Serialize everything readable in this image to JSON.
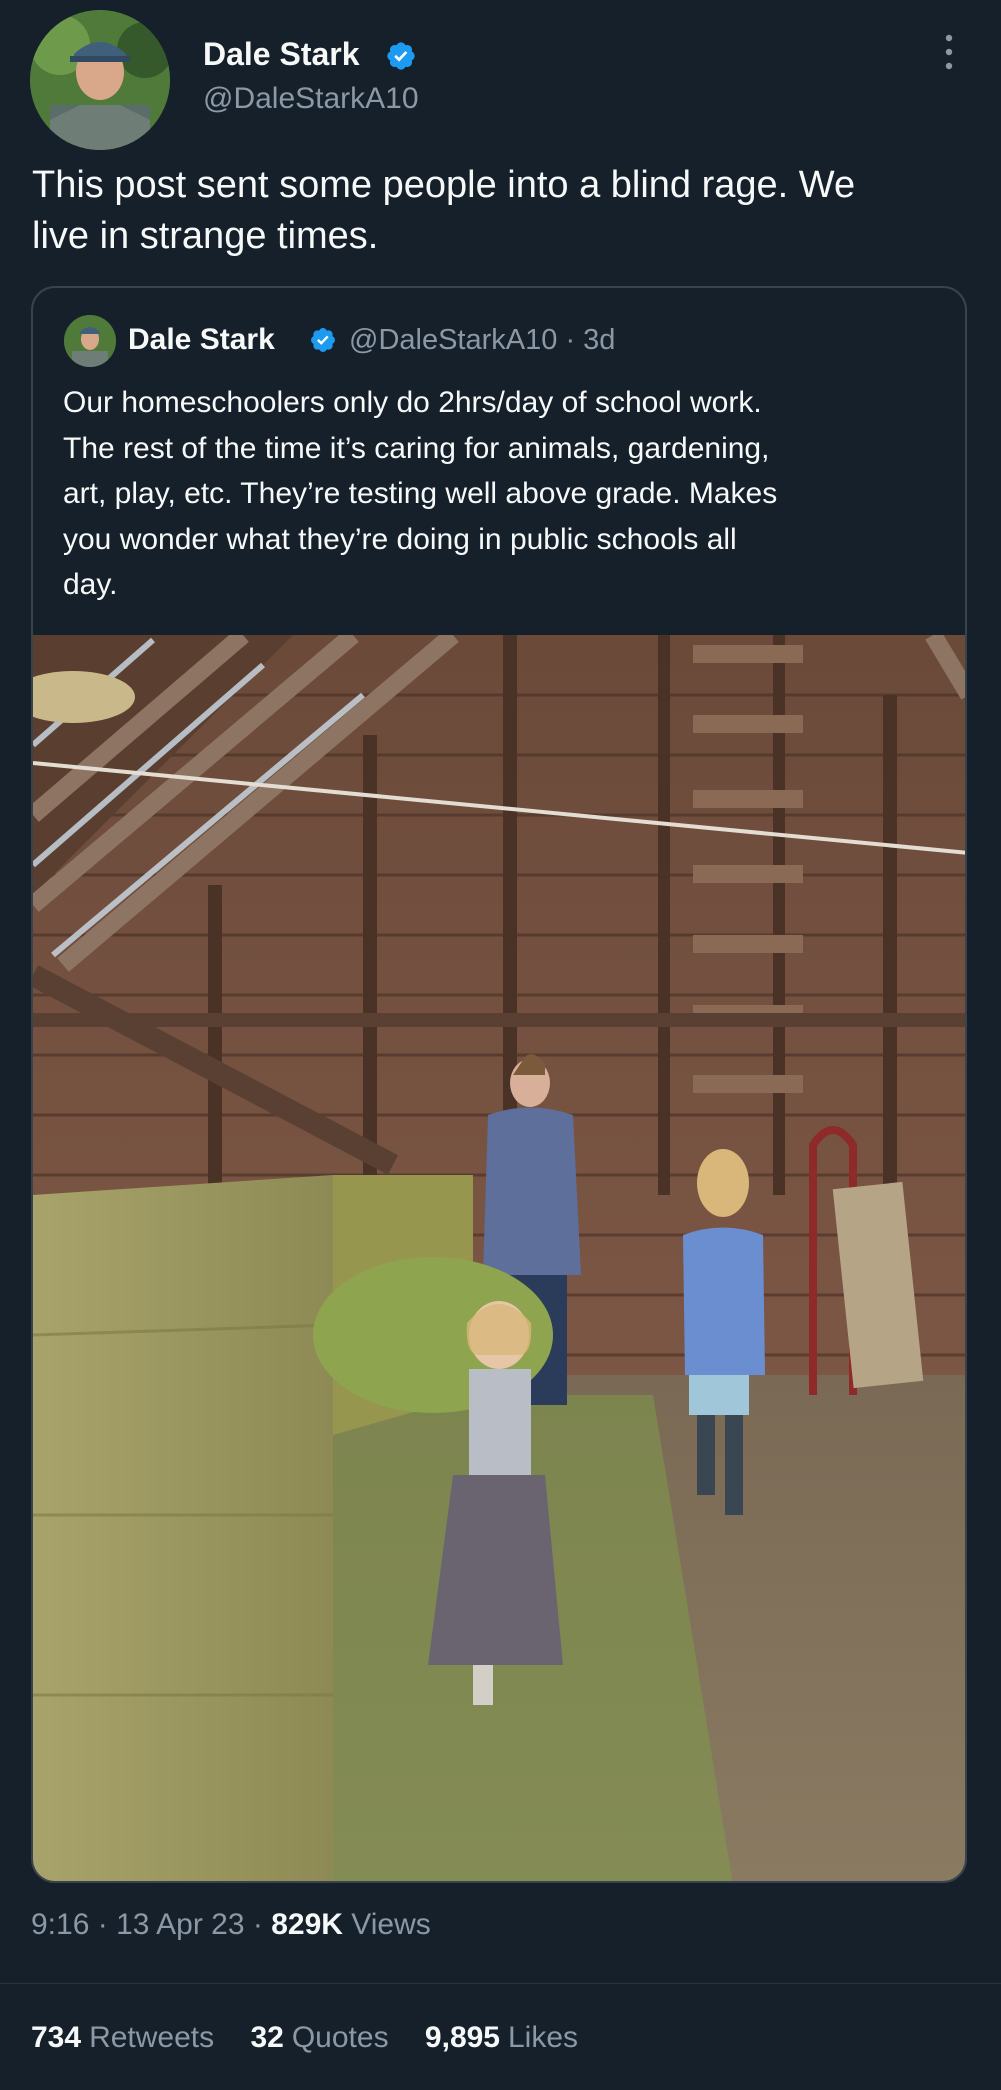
{
  "tweet": {
    "author_name": "Dale Stark",
    "author_handle": "@DaleStarkA10",
    "text_line1": "This post sent some people into a blind rage. We",
    "text_line2": "live in strange times."
  },
  "quoted": {
    "author_name": "Dale Stark",
    "author_handle": "@DaleStarkA10",
    "age": "· 3d",
    "text_lines": [
      "Our homeschoolers only do 2hrs/day of school work.",
      "The rest of the time it’s caring for animals, gardening,",
      "art, play, etc. They’re testing well above grade. Makes",
      "you wonder what they’re doing in public schools all",
      "day."
    ]
  },
  "meta": {
    "time": "9:16",
    "sep1": "·",
    "date": "13 Apr 23",
    "sep2": "·",
    "views_count": "829K",
    "views_label": "Views"
  },
  "stats": {
    "retweets_count": "734",
    "retweets_label": "Retweets",
    "quotes_count": "32",
    "quotes_label": "Quotes",
    "likes_count": "9,895",
    "likes_label": "Likes"
  },
  "colors": {
    "background": "#15202b",
    "text_primary": "#f7f9f9",
    "text_secondary": "#8b98a5",
    "verified_badge": "#1d9bf0",
    "border": "#38444d"
  },
  "icons": {
    "verified": "verified-badge-icon",
    "more": "more-vertical-icon"
  }
}
